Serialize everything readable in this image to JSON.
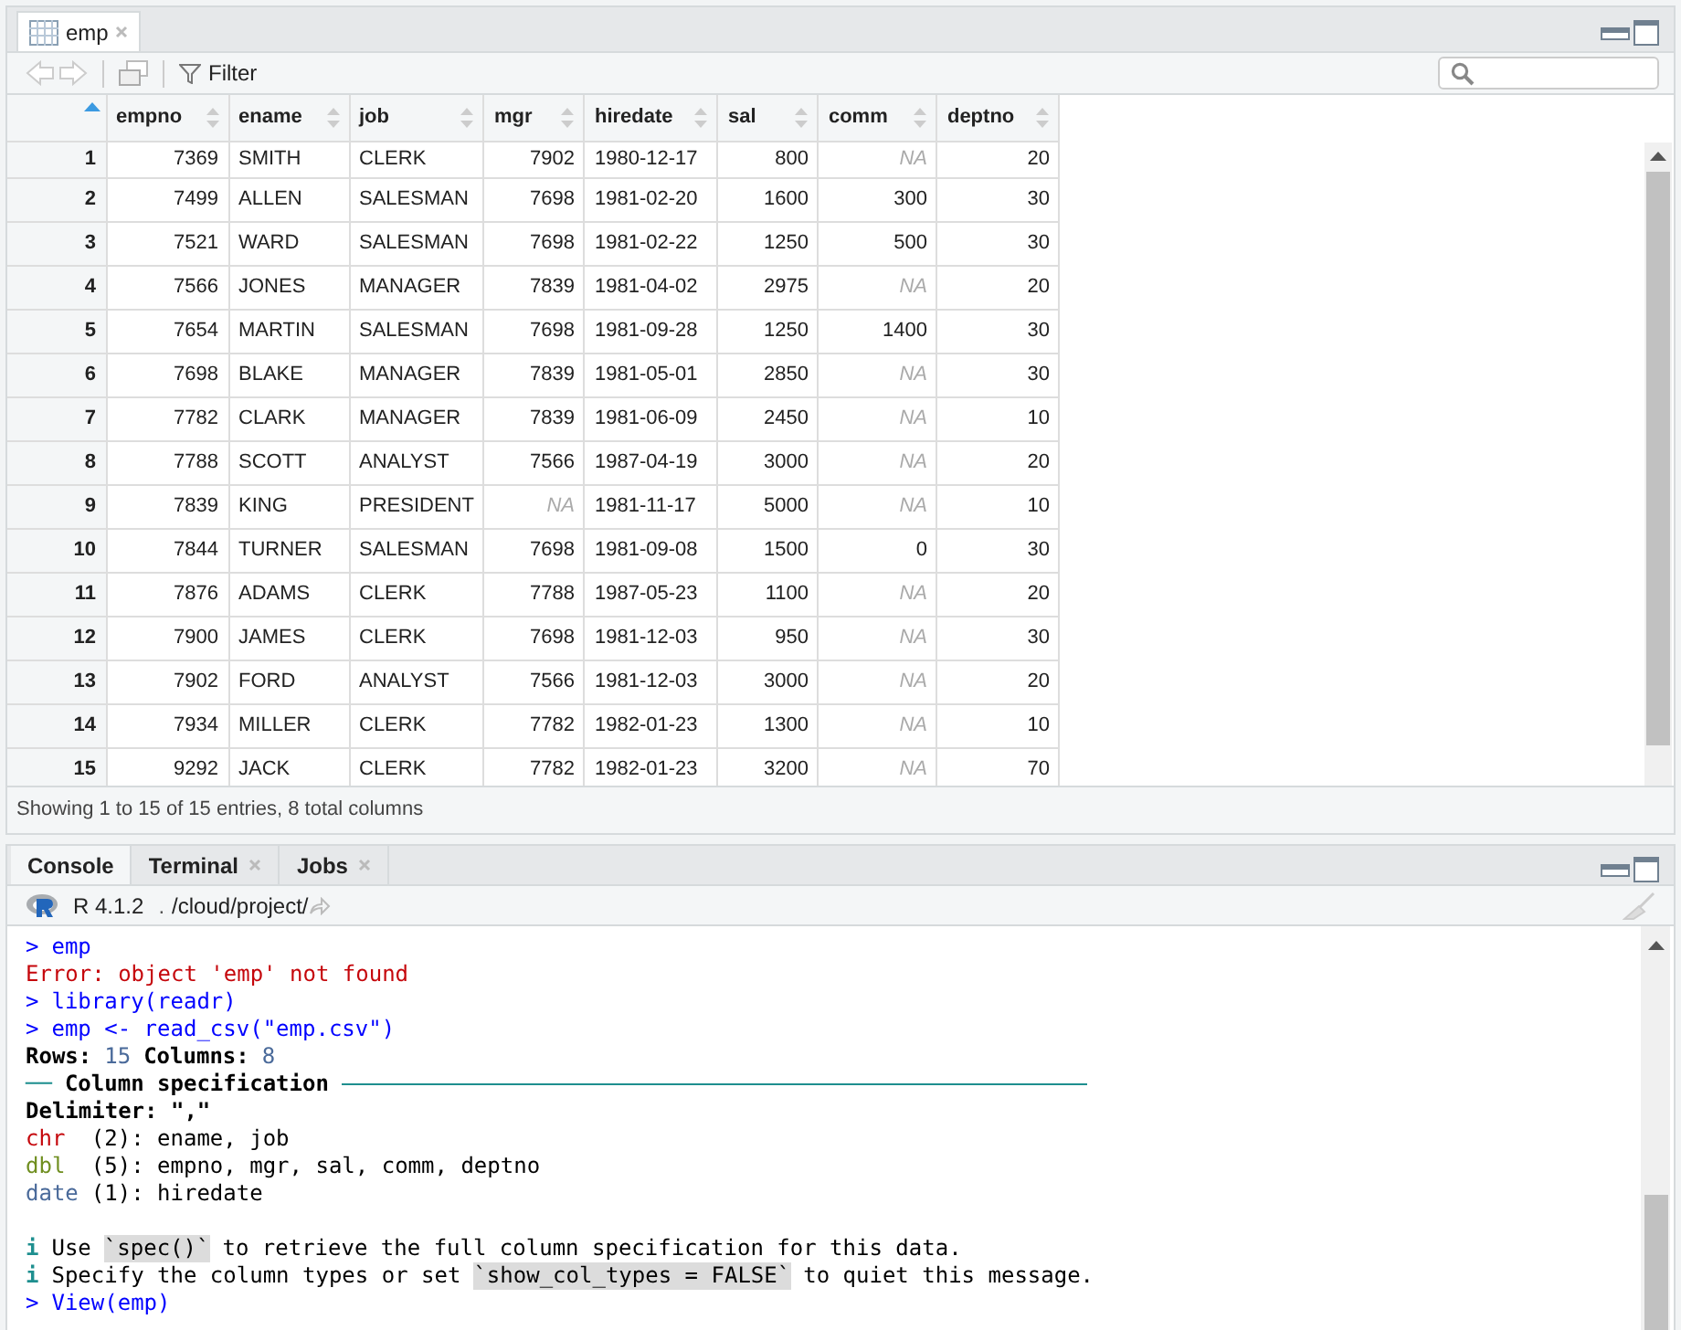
{
  "viewer": {
    "tab": {
      "label": "emp",
      "selected": true
    },
    "filter": "Filter",
    "table": {
      "index_sorted": true,
      "columns": [
        "empno",
        "ename",
        "job",
        "mgr",
        "hiredate",
        "sal",
        "comm",
        "deptno"
      ],
      "rows": [
        {
          "n": "1",
          "cells": [
            "7369",
            "SMITH",
            "CLERK",
            "7902",
            "1980-12-17",
            "800",
            {
              "value": "NA",
              "missing": true
            },
            "20"
          ]
        },
        {
          "n": "2",
          "cells": [
            "7499",
            "ALLEN",
            "SALESMAN",
            "7698",
            "1981-02-20",
            "1600",
            "300",
            "30"
          ]
        },
        {
          "n": "3",
          "cells": [
            "7521",
            "WARD",
            "SALESMAN",
            "7698",
            "1981-02-22",
            "1250",
            "500",
            "30"
          ]
        },
        {
          "n": "4",
          "cells": [
            "7566",
            "JONES",
            "MANAGER",
            "7839",
            "1981-04-02",
            "2975",
            {
              "value": "NA",
              "missing": true
            },
            "20"
          ]
        },
        {
          "n": "5",
          "cells": [
            "7654",
            "MARTIN",
            "SALESMAN",
            "7698",
            "1981-09-28",
            "1250",
            "1400",
            "30"
          ]
        },
        {
          "n": "6",
          "cells": [
            "7698",
            "BLAKE",
            "MANAGER",
            "7839",
            "1981-05-01",
            "2850",
            {
              "value": "NA",
              "missing": true
            },
            "30"
          ]
        },
        {
          "n": "7",
          "cells": [
            "7782",
            "CLARK",
            "MANAGER",
            "7839",
            "1981-06-09",
            "2450",
            {
              "value": "NA",
              "missing": true
            },
            "10"
          ]
        },
        {
          "n": "8",
          "cells": [
            "7788",
            "SCOTT",
            "ANALYST",
            "7566",
            "1987-04-19",
            "3000",
            {
              "value": "NA",
              "missing": true
            },
            "20"
          ]
        },
        {
          "n": "9",
          "cells": [
            "7839",
            "KING",
            "PRESIDENT",
            {
              "value": "NA",
              "missing": true
            },
            "1981-11-17",
            "5000",
            {
              "value": "NA",
              "missing": true
            },
            "10"
          ]
        },
        {
          "n": "10",
          "cells": [
            "7844",
            "TURNER",
            "SALESMAN",
            "7698",
            "1981-09-08",
            "1500",
            "0",
            "30"
          ]
        },
        {
          "n": "11",
          "cells": [
            "7876",
            "ADAMS",
            "CLERK",
            "7788",
            "1987-05-23",
            "1100",
            {
              "value": "NA",
              "missing": true
            },
            "20"
          ]
        },
        {
          "n": "12",
          "cells": [
            "7900",
            "JAMES",
            "CLERK",
            "7698",
            "1981-12-03",
            "950",
            {
              "value": "NA",
              "missing": true
            },
            "30"
          ]
        },
        {
          "n": "13",
          "cells": [
            "7902",
            "FORD",
            "ANALYST",
            "7566",
            "1981-12-03",
            "3000",
            {
              "value": "NA",
              "missing": true
            },
            "20"
          ]
        },
        {
          "n": "14",
          "cells": [
            "7934",
            "MILLER",
            "CLERK",
            "7782",
            "1982-01-23",
            "1300",
            {
              "value": "NA",
              "missing": true
            },
            "10"
          ]
        },
        {
          "n": "15",
          "cells": [
            "9292",
            "JACK",
            "CLERK",
            "7782",
            "1982-01-23",
            "3200",
            {
              "value": "NA",
              "missing": true
            },
            "70"
          ]
        }
      ]
    },
    "footer": "Showing 1 to 15 of 15 entries, 8 total columns"
  },
  "console_pane": {
    "tabs": [
      {
        "label": "Console",
        "selected": true,
        "closable": false
      },
      {
        "label": "Terminal",
        "selected": false,
        "closable": true
      },
      {
        "label": "Jobs",
        "selected": false,
        "closable": true
      }
    ],
    "version": "R 4.1.2",
    "separator": ".",
    "path": "/cloud/project/",
    "lines": [
      {
        "segments": [
          {
            "kind": "prompt",
            "text": ">"
          },
          {
            "kind": "command",
            "text": "emp"
          }
        ]
      },
      {
        "segments": [
          {
            "kind": "error",
            "text": "Error: object 'emp' not found"
          }
        ]
      },
      {
        "segments": [
          {
            "kind": "prompt",
            "text": ">"
          },
          {
            "kind": "command",
            "text": "library(readr)"
          }
        ]
      },
      {
        "segments": [
          {
            "kind": "prompt",
            "text": ">"
          },
          {
            "kind": "command",
            "text": "emp <- read_csv(\"emp.csv\")"
          }
        ]
      },
      {
        "segments": [
          {
            "kind": "bold",
            "text": "Rows:"
          },
          {
            "kind": "number",
            "text": "15"
          },
          {
            "kind": "bold",
            "text": "Columns:"
          },
          {
            "kind": "number",
            "text": "8"
          }
        ]
      },
      {
        "segments": [
          {
            "kind": "rule",
            "text": "──"
          },
          {
            "kind": "bold",
            "text": "Column specification"
          },
          {
            "kind": "rule_line"
          }
        ]
      },
      {
        "segments": [
          {
            "kind": "bold",
            "text": "Delimiter: \",\""
          }
        ]
      },
      {
        "segments": [
          {
            "kind": "chr",
            "text": "chr "
          },
          {
            "kind": "plain",
            "text": "(2): ename, job"
          }
        ]
      },
      {
        "segments": [
          {
            "kind": "dbl",
            "text": "dbl "
          },
          {
            "kind": "plain",
            "text": "(5): empno, mgr, sal, comm, deptno"
          }
        ]
      },
      {
        "segments": [
          {
            "kind": "date",
            "text": "date"
          },
          {
            "kind": "plain",
            "text": "(1): hiredate"
          }
        ]
      },
      {
        "spaced": true,
        "segments": [
          {
            "kind": "info",
            "text": "i"
          },
          {
            "kind": "plain",
            "text": "Use"
          },
          {
            "kind": "code",
            "text": "`spec()`"
          },
          {
            "kind": "plain",
            "text": "to retrieve the full column specification for this data."
          }
        ]
      },
      {
        "segments": [
          {
            "kind": "info",
            "text": "i"
          },
          {
            "kind": "plain",
            "text": "Specify the column types or set"
          },
          {
            "kind": "code",
            "text": "`show_col_types = FALSE`"
          },
          {
            "kind": "plain",
            "text": "to quiet this message."
          }
        ]
      },
      {
        "segments": [
          {
            "kind": "prompt",
            "text": ">"
          },
          {
            "kind": "command",
            "text": "View(emp)"
          }
        ]
      }
    ]
  }
}
